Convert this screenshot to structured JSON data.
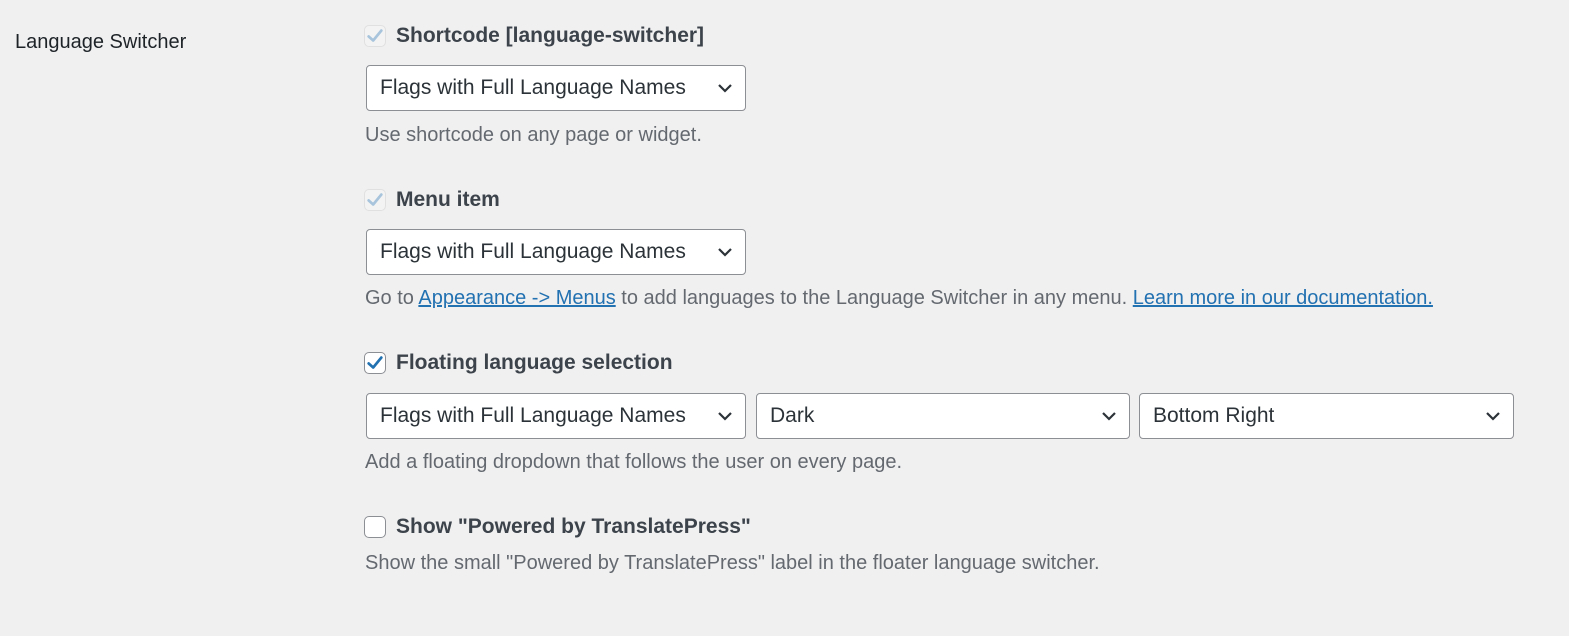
{
  "section": {
    "label": "Language Switcher"
  },
  "shortcode": {
    "checkbox_label": "Shortcode [language-switcher]",
    "checked": true,
    "disabled": true,
    "select_value": "Flags with Full Language Names",
    "description": "Use shortcode on any page or widget."
  },
  "menu_item": {
    "checkbox_label": "Menu item",
    "checked": true,
    "disabled": true,
    "select_value": "Flags with Full Language Names",
    "description_prefix": "Go to ",
    "description_link": "Appearance -> Menus",
    "description_middle": " to add languages to the Language Switcher in any menu. ",
    "description_link2": "Learn more in our documentation."
  },
  "floating": {
    "checkbox_label": "Floating language selection",
    "checked": true,
    "select_value": "Flags with Full Language Names",
    "theme_value": "Dark",
    "position_value": "Bottom Right",
    "description": "Add a floating dropdown that follows the user on every page."
  },
  "powered_by": {
    "checkbox_label": "Show \"Powered by TranslatePress\"",
    "checked": false,
    "description": "Show the small \"Powered by TranslatePress\" label in the floater language switcher."
  },
  "colors": {
    "link": "#2271b1",
    "checkmark": "#2271b1",
    "checkmark_disabled": "#a7c4dc"
  }
}
